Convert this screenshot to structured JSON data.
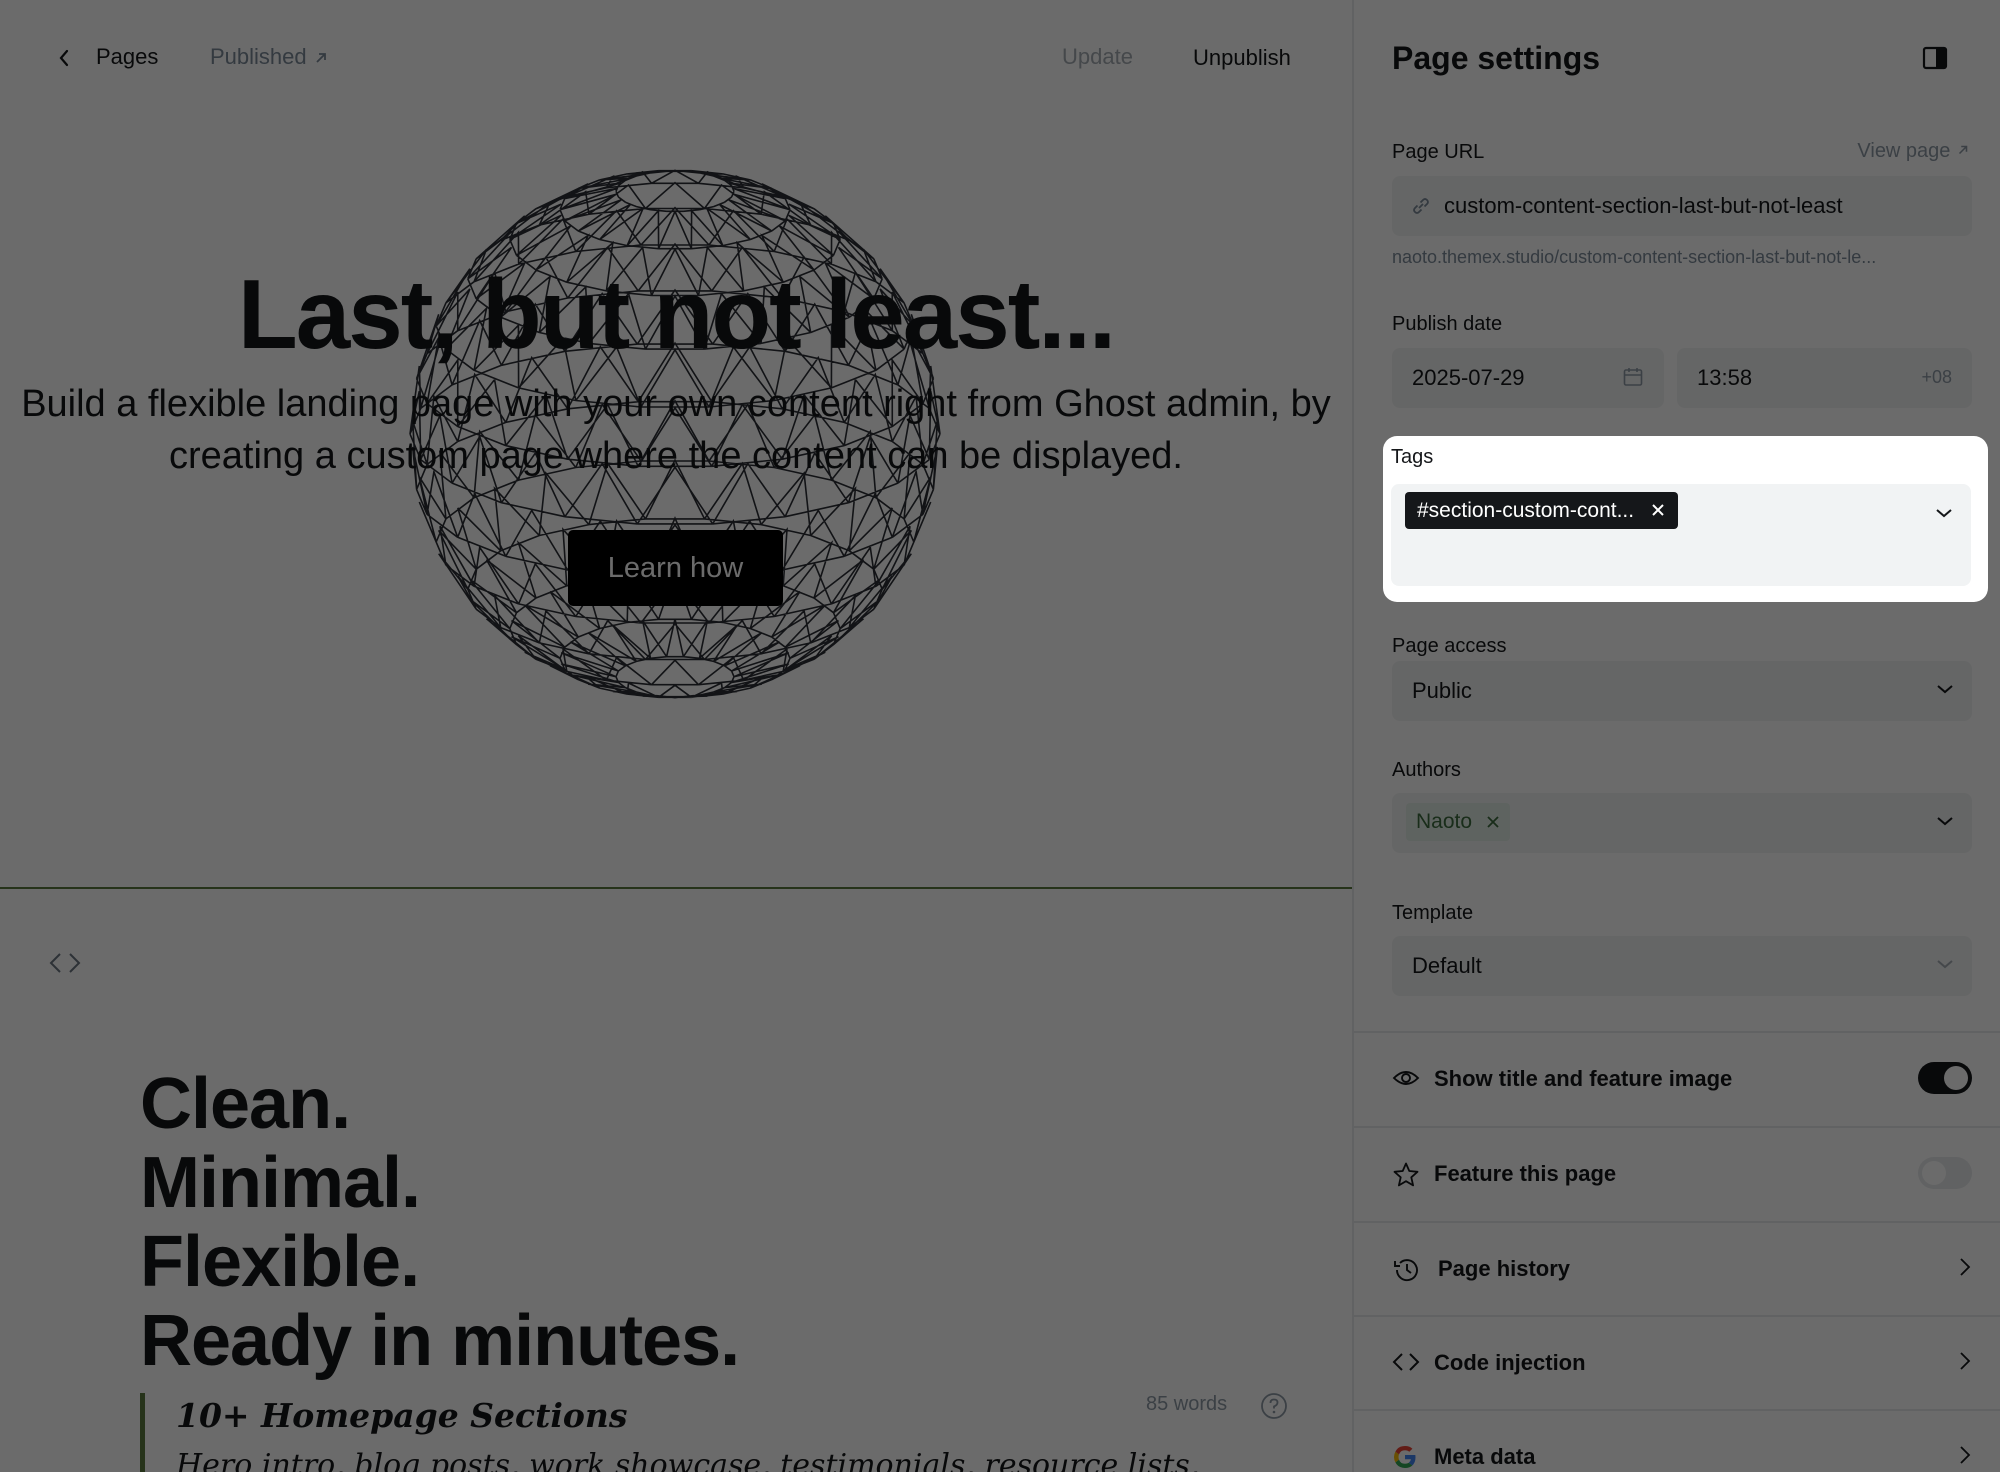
{
  "editor": {
    "back_label": "Pages",
    "status_label": "Published",
    "update_label": "Update",
    "unpublish_label": "Unpublish",
    "hero": {
      "title": "Last, but not least...",
      "subtitle": "Build a flexible landing page with your own content right from Ghost admin, by creating a custom page where the content can be displayed.",
      "button_label": "Learn how"
    },
    "headline_lines": [
      "Clean.",
      "Minimal.",
      "Flexible.",
      "Ready in minutes."
    ],
    "quote_title": "10+ Homepage Sections",
    "quote_text": "Hero intro, blog posts, work showcase, testimonials, resource lists,",
    "word_count": "85 words"
  },
  "settings": {
    "title": "Page settings",
    "page_url_label": "Page URL",
    "view_page_label": "View page",
    "page_url_value": "custom-content-section-last-but-not-least",
    "page_url_hint": "naoto.themex.studio/custom-content-section-last-but-not-le...",
    "publish_date_label": "Publish date",
    "publish_date": "2025-07-29",
    "publish_time": "13:58",
    "timezone": "+08",
    "tags_label": "Tags",
    "tag_chip": "#section-custom-cont...",
    "access_label": "Page access",
    "access_value": "Public",
    "authors_label": "Authors",
    "author_chip": "Naoto",
    "template_label": "Template",
    "template_value": "Default",
    "rows": {
      "show_title": "Show title and feature image",
      "feature": "Feature this page",
      "history": "Page history",
      "code_injection": "Code injection",
      "meta_data": "Meta data"
    },
    "show_title_enabled": true,
    "feature_enabled": false
  }
}
